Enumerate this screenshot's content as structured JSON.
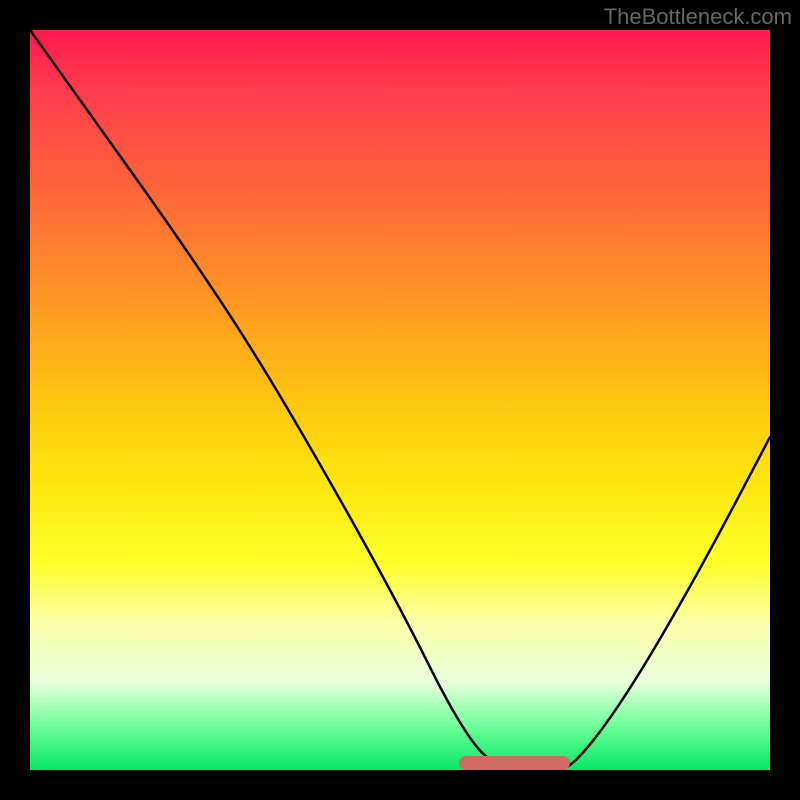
{
  "watermark": "TheBottleneck.com",
  "chart_data": {
    "type": "line",
    "title": "",
    "xlabel": "",
    "ylabel": "",
    "xlim": [
      0,
      100
    ],
    "ylim": [
      0,
      100
    ],
    "series": [
      {
        "name": "bottleneck-curve",
        "x": [
          0,
          10,
          20,
          30,
          40,
          50,
          58,
          63,
          70,
          73,
          80,
          90,
          100
        ],
        "values": [
          100,
          86,
          72,
          57,
          40,
          22,
          6,
          0,
          0,
          0,
          9,
          26,
          45
        ]
      }
    ],
    "plateau": {
      "start_x": 58,
      "end_x": 73,
      "thickness_pct": 1.9
    },
    "gradient_stops": [
      {
        "pct": 0,
        "color": "#ff1a4d"
      },
      {
        "pct": 18,
        "color": "#ff5a3e"
      },
      {
        "pct": 40,
        "color": "#ffa31e"
      },
      {
        "pct": 62,
        "color": "#ffe810"
      },
      {
        "pct": 80,
        "color": "#fbffa8"
      },
      {
        "pct": 94,
        "color": "#6fff9a"
      },
      {
        "pct": 100,
        "color": "#06e763"
      }
    ]
  }
}
